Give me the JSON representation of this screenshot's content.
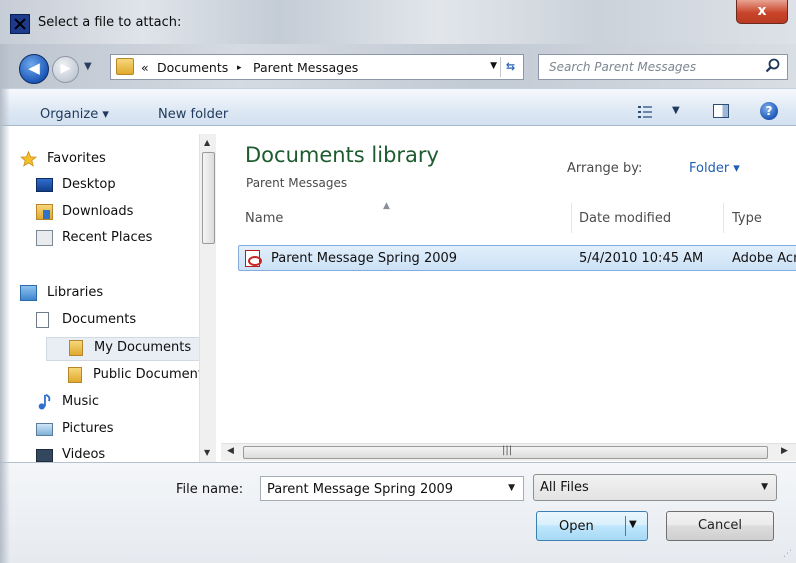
{
  "window": {
    "title": "Select a file to attach:",
    "close_label": "x"
  },
  "address": {
    "overflow": "«",
    "crumbs": [
      "Documents",
      "Parent Messages"
    ],
    "separator": "▸"
  },
  "search": {
    "placeholder": "Search Parent Messages"
  },
  "toolbar": {
    "organize_label": "Organize ▾",
    "new_folder_label": "New folder"
  },
  "nav": {
    "items": [
      {
        "label": "Favorites",
        "icon": "star-icon"
      },
      {
        "label": "Desktop",
        "icon": "desktop-icon"
      },
      {
        "label": "Downloads",
        "icon": "downloads-icon"
      },
      {
        "label": "Recent Places",
        "icon": "recent-places-icon"
      },
      {
        "label": "Libraries",
        "icon": "libraries-icon"
      },
      {
        "label": "Documents",
        "icon": "documents-icon"
      },
      {
        "label": "My Documents",
        "icon": "folder-icon"
      },
      {
        "label": "Public Documents",
        "icon": "folder-icon"
      },
      {
        "label": "Music",
        "icon": "music-icon"
      },
      {
        "label": "Pictures",
        "icon": "pictures-icon"
      },
      {
        "label": "Videos",
        "icon": "videos-icon"
      }
    ]
  },
  "library": {
    "title": "Documents library",
    "subtitle": "Parent Messages",
    "arrange_label": "Arrange by:",
    "arrange_value": "Folder ▾"
  },
  "columns": [
    "Name",
    "Date modified",
    "Type"
  ],
  "files": [
    {
      "name": "Parent Message Spring 2009",
      "date": "5/4/2010 10:45 AM",
      "type": "Adobe Acrobat Document"
    }
  ],
  "bottom": {
    "filename_label": "File name:",
    "filename_value": "Parent Message Spring 2009",
    "filetype_value": "All Files",
    "open_label": "Open",
    "cancel_label": "Cancel"
  },
  "colors": {
    "library_title": "#1e5b2f",
    "link": "#1f5fb4",
    "selection": "#cce1f6"
  }
}
